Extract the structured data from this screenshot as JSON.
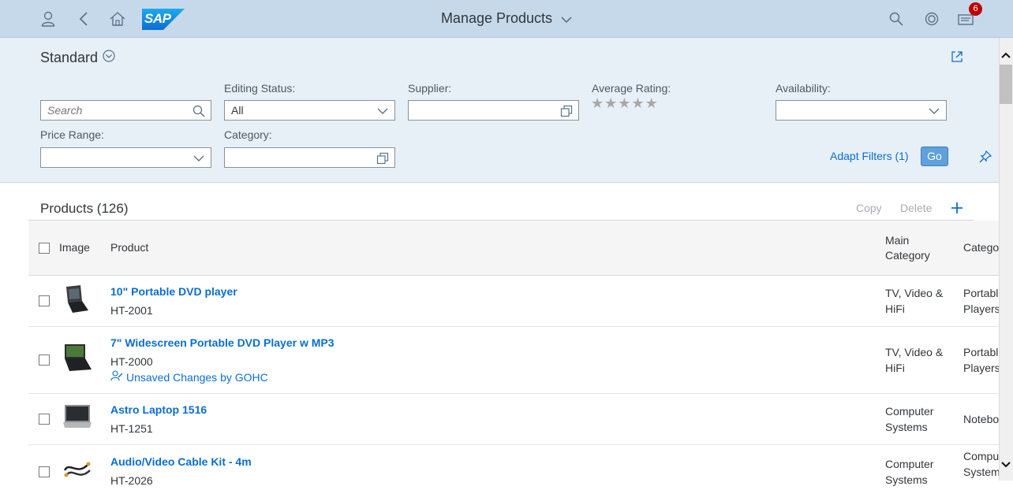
{
  "shell": {
    "title": "Manage Products",
    "logo_text": "SAP",
    "notification_count": "6",
    "icons": [
      "user-icon",
      "back-icon",
      "home-icon",
      "search-icon",
      "copilot-icon",
      "notifications-icon"
    ]
  },
  "filter_bar": {
    "variant": "Standard",
    "search_placeholder": "Search",
    "editing_status_label": "Editing Status:",
    "editing_status_value": "All",
    "supplier_label": "Supplier:",
    "supplier_value": "",
    "rating_label": "Average Rating:",
    "rating_value": 0,
    "availability_label": "Availability:",
    "availability_value": "",
    "price_range_label": "Price Range:",
    "price_range_value": "",
    "category_label": "Category:",
    "category_value": "",
    "adapt_filters": "Adapt Filters (1)",
    "go": "Go"
  },
  "table": {
    "title": "Products (126)",
    "toolbar": {
      "copy": "Copy",
      "delete": "Delete"
    },
    "headers": {
      "image": "Image",
      "product": "Product",
      "main_category_line1": "Main",
      "main_category_line2": "Category",
      "category": "Catego"
    },
    "rows": [
      {
        "name": "10\" Portable DVD player",
        "id": "HT-2001",
        "draft": "",
        "main_category": [
          "TV, Video &",
          "HiFi"
        ],
        "category": [
          "Portabl",
          "Players"
        ],
        "image": "portable-dvd-player"
      },
      {
        "name": "7\" Widescreen Portable DVD Player w MP3",
        "id": "HT-2000",
        "draft": "Unsaved Changes by GOHC",
        "main_category": [
          "TV, Video &",
          "HiFi"
        ],
        "category": [
          "Portabl",
          "Players"
        ],
        "image": "widescreen-dvd-player"
      },
      {
        "name": "Astro Laptop 1516",
        "id": "HT-1251",
        "draft": "",
        "main_category": [
          "Computer",
          "Systems"
        ],
        "category": [
          "Notebo",
          ""
        ],
        "image": "laptop"
      },
      {
        "name": "Audio/Video Cable Kit - 4m",
        "id": "HT-2026",
        "draft": "",
        "main_category": [
          "Computer",
          "Systems"
        ],
        "category": [
          "Compu",
          "System"
        ],
        "image": "cable-kit"
      }
    ]
  },
  "colors": {
    "shell_bg": "#c6d9ea",
    "filter_bg": "#e7eff7",
    "link": "#0a6ed1",
    "go_button": "#5fa0dd",
    "badge": "#bb0000"
  }
}
